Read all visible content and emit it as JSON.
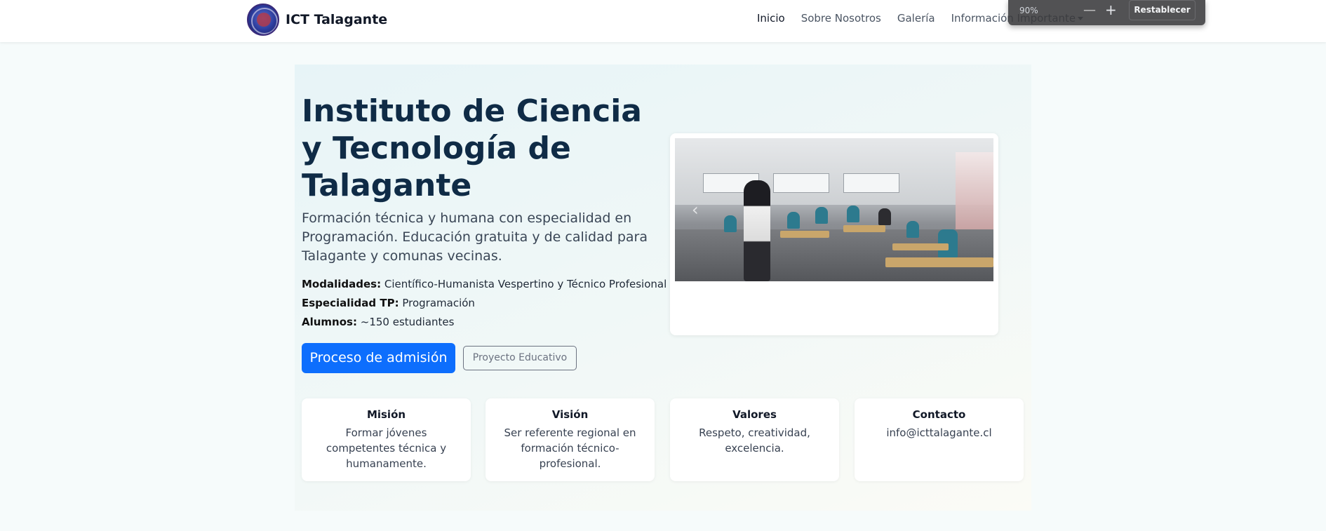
{
  "navbar": {
    "brand": "ICT Talagante",
    "links": [
      {
        "label": "Inicio"
      },
      {
        "label": "Sobre Nosotros"
      },
      {
        "label": "Galería"
      },
      {
        "label": "Información Importante"
      }
    ]
  },
  "zoom_popup": {
    "level": "90%",
    "minus": "—",
    "plus": "+",
    "reset_label": "Restablecer"
  },
  "hero": {
    "title": "Instituto de Ciencia y Tecnología de Talagante",
    "lead": "Formación técnica y humana con especialidad en Programación. Educación gratuita y de calidad para Talagante y comunas vecinas.",
    "facts": [
      {
        "label": "Modalidades:",
        "value": "Científico-Humanista Vespertino y Técnico Profesional"
      },
      {
        "label": "Especialidad TP:",
        "value": "Programación"
      },
      {
        "label": "Alumnos:",
        "value": "~150 estudiantes"
      }
    ],
    "primary_button": "Proceso de admisión",
    "secondary_button": "Proyecto Educativo"
  },
  "carousel": {
    "prev_icon": "‹"
  },
  "cards": [
    {
      "title": "Misión",
      "text": "Formar jóvenes competentes técnica y humanamente."
    },
    {
      "title": "Visión",
      "text": "Ser referente regional en formación técnico-profesional."
    },
    {
      "title": "Valores",
      "text": "Respeto, creatividad, excelencia."
    },
    {
      "title": "Contacto",
      "text": "info@icttalagante.cl"
    }
  ],
  "colors": {
    "primary": "#0d6efd",
    "title": "#0f2b46"
  }
}
